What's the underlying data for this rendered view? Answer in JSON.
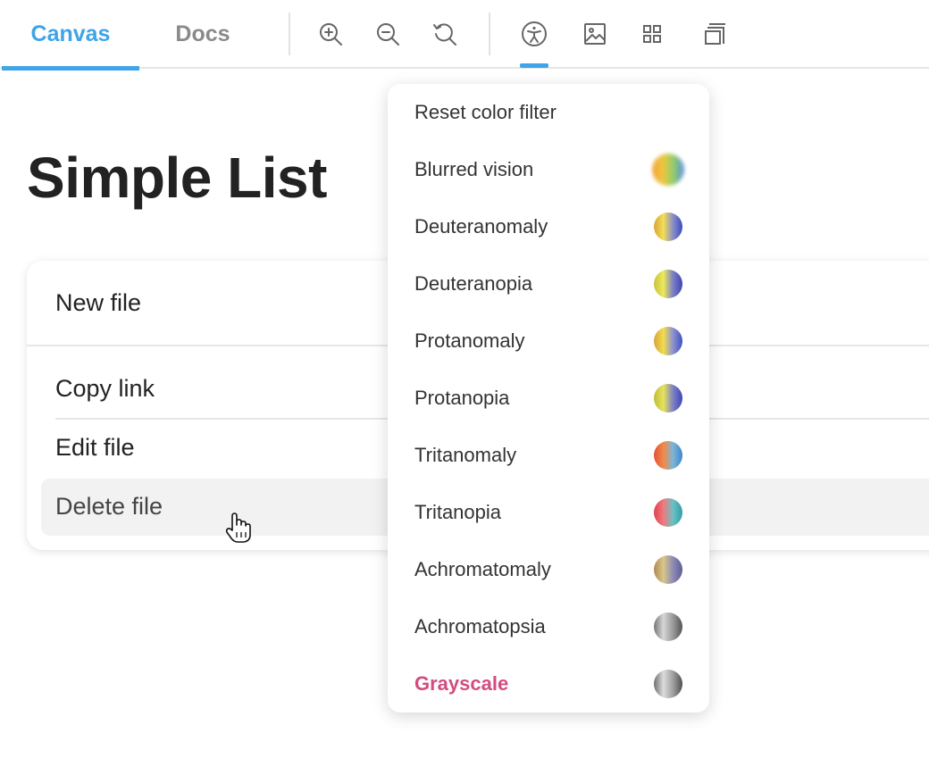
{
  "tabs": [
    {
      "label": "Canvas",
      "active": true
    },
    {
      "label": "Docs",
      "active": false
    }
  ],
  "tools": [
    "zoom-in-icon",
    "zoom-out-icon",
    "reset-zoom-icon",
    "accessibility-icon",
    "image-icon",
    "grid-icon",
    "layers-icon"
  ],
  "accent_color": "#3fa4e8",
  "page_title": "Simple List",
  "list": {
    "items": [
      "New file",
      "Copy link",
      "Edit file",
      "Delete file"
    ]
  },
  "menu": {
    "reset_label": "Reset color filter",
    "filters": [
      {
        "label": "Blurred vision"
      },
      {
        "label": "Deuteranomaly"
      },
      {
        "label": "Deuteranopia"
      },
      {
        "label": "Protanomaly"
      },
      {
        "label": "Protanopia"
      },
      {
        "label": "Tritanomaly"
      },
      {
        "label": "Tritanopia"
      },
      {
        "label": "Achromatomaly"
      },
      {
        "label": "Achromatopsia"
      },
      {
        "label": "Grayscale",
        "selected": true
      }
    ],
    "selected_color": "#d34c7f"
  }
}
